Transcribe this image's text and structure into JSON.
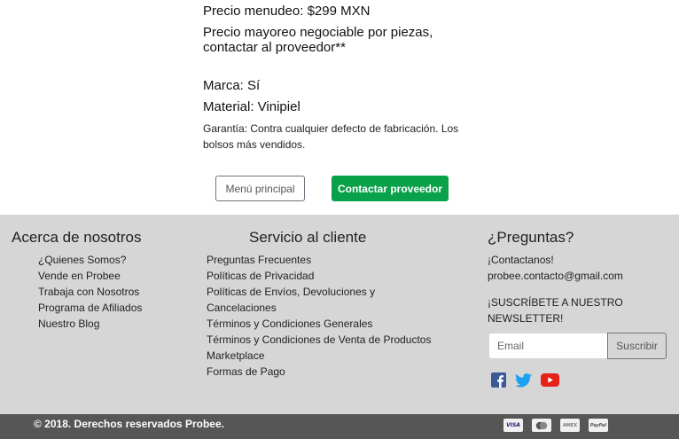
{
  "product": {
    "precio_menudeo": "Precio menudeo: $299 MXN",
    "precio_mayoreo": "Precio mayoreo negociable por piezas, contactar al proveedor**",
    "marca": "Marca: Sí",
    "material": "Material: Vinipiel",
    "garantia": "Garantía: Contra cualquier defecto de fabricación. Los bolsos más vendidos."
  },
  "buttons": {
    "menu_principal": "Menú principal",
    "contactar": "Contactar proveedor"
  },
  "footer": {
    "about": {
      "title": "Acerca de nosotros",
      "items": [
        "¿Quienes Somos?",
        "Vende en Probee",
        "Trabaja con Nosotros",
        "Programa de Afiliados",
        "Nuestro Blog"
      ]
    },
    "service": {
      "title": "Servicio al cliente",
      "items": [
        "Preguntas Frecuentes",
        "Políticas de Privacidad",
        "Políticas de Envíos, Devoluciones y Cancelaciones",
        "Términos y Condiciones Generales",
        "Términos y Condiciones de Venta de Productos Marketplace",
        "Formas de Pago"
      ]
    },
    "questions": {
      "title": "¿Preguntas?",
      "contact_line1": "¡Contactanos!",
      "contact_line2": "probee.contacto@gmail.com",
      "newsletter": "¡SUSCRÍBETE A NUESTRO NEWSLETTER!",
      "email_placeholder": "Email",
      "subscribe": "Suscribir"
    },
    "social": {
      "icons": [
        "facebook-icon",
        "twitter-icon",
        "youtube-icon"
      ],
      "colors": {
        "facebook": "#3b5998",
        "twitter": "#1da1f2",
        "youtube": "#e62117"
      }
    }
  },
  "bottom": {
    "copyright": "© 2018. Derechos reservados Probee.",
    "cards": [
      "VISA",
      "mastercard",
      "AMEX",
      "PayPal"
    ]
  },
  "colors": {
    "accent_green": "#0aa14b",
    "footer_bg": "#d6d6d6",
    "bottom_bg": "#565656"
  }
}
